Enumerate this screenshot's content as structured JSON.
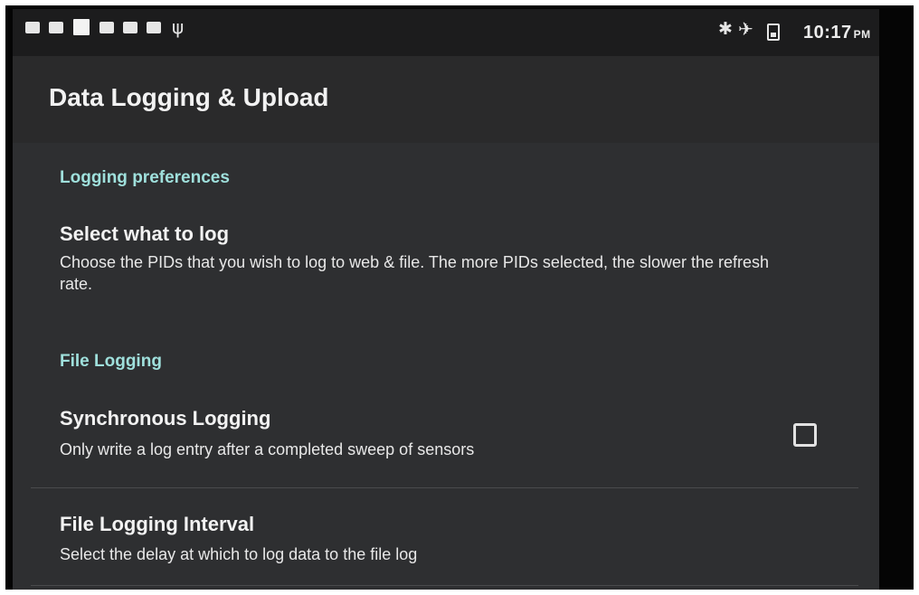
{
  "status_bar": {
    "time": "10:17",
    "ampm": "PM",
    "notification_icons": [
      "notification-icon",
      "notification-icon",
      "notification-icon",
      "notification-icon",
      "notification-icon",
      "image-icon",
      "usb-icon"
    ],
    "system_icons": [
      "bluetooth-icon",
      "airplane-mode-icon",
      "battery-icon"
    ]
  },
  "app_bar": {
    "title": "Data Logging & Upload"
  },
  "sections": [
    {
      "category": "Logging preferences",
      "items": [
        {
          "title": "Select what to log",
          "summary": "Choose the PIDs that you wish to log to web & file. The more PIDs selected, the slower the refresh rate."
        }
      ]
    },
    {
      "category": "File Logging",
      "items": [
        {
          "title": "Synchronous Logging",
          "summary": "Only write a log entry after a completed sweep of sensors",
          "checked": false
        },
        {
          "title": "File Logging Interval",
          "summary": "Select the delay at which to log data to the file log"
        }
      ]
    }
  ]
}
